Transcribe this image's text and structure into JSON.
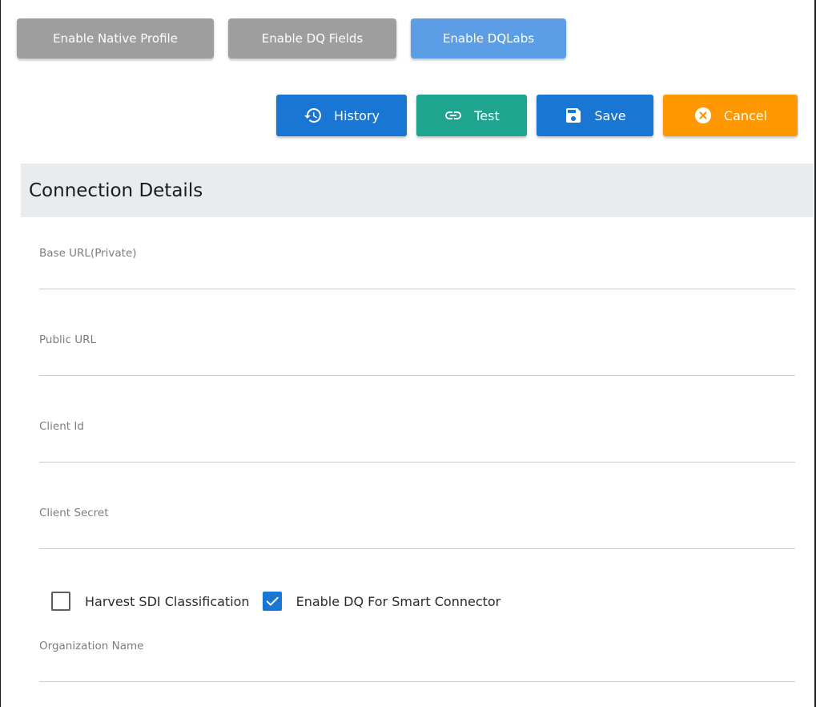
{
  "toggles": {
    "native_profile": "Enable Native Profile",
    "dq_fields": "Enable DQ Fields",
    "dqlabs": "Enable DQLabs"
  },
  "actions": {
    "history": "History",
    "test": "Test",
    "save": "Save",
    "cancel": "Cancel"
  },
  "section": {
    "title": "Connection Details"
  },
  "fields": {
    "base_url": {
      "label": "Base URL(Private)",
      "value": ""
    },
    "public_url": {
      "label": "Public URL",
      "value": ""
    },
    "client_id": {
      "label": "Client Id",
      "value": ""
    },
    "client_secret": {
      "label": "Client Secret",
      "value": ""
    },
    "organization_name": {
      "label": "Organization Name",
      "value": ""
    }
  },
  "checkboxes": {
    "harvest_sdi": {
      "label": "Harvest SDI Classification",
      "checked": false
    },
    "enable_dq_smart": {
      "label": "Enable DQ For Smart Connector",
      "checked": true
    }
  },
  "colors": {
    "toggle_inactive": "#9e9e9e",
    "toggle_active": "#5c9ee6",
    "primary": "#1976d2",
    "test": "#1fa58f",
    "cancel": "#ff9800",
    "section_bg": "#e9ecef"
  },
  "icons": {
    "history": "history-icon",
    "test": "link-icon",
    "save": "floppy-disk-icon",
    "cancel": "cancel-circle-icon",
    "check": "checkmark-icon"
  }
}
